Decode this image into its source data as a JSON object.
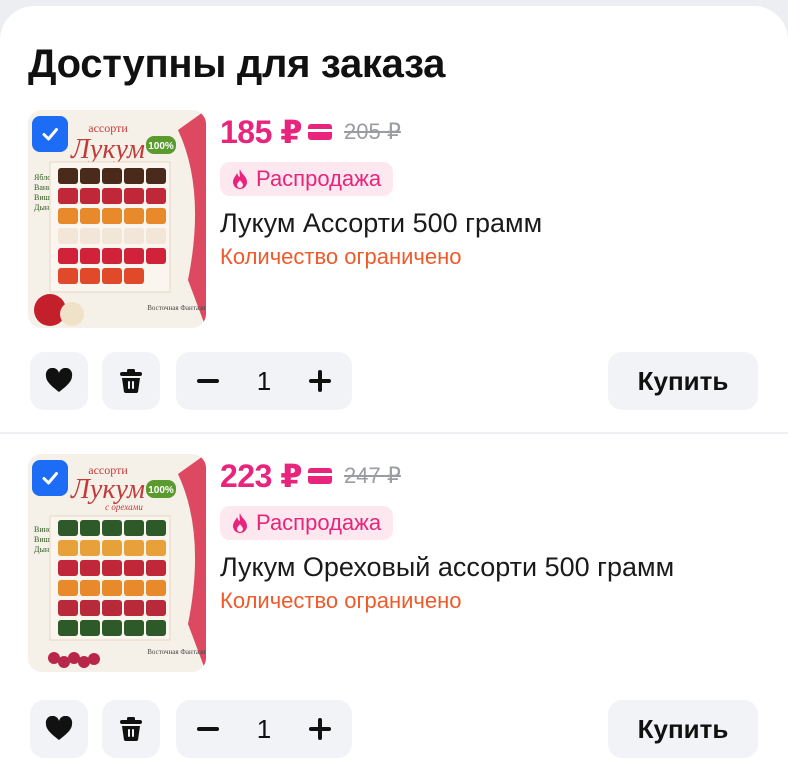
{
  "section": {
    "title": "Доступны для заказа"
  },
  "items": [
    {
      "price": "185 ₽",
      "old_price": "205 ₽",
      "badge": "Распродажа",
      "name": "Лукум Ассорти 500 грамм",
      "limited": "Количество ограничено",
      "quantity": "1",
      "buy_label": "Купить",
      "image": {
        "brand_top": "ассорти",
        "brand": "Лукум",
        "flavors": [
          "Яблоко",
          "Ваниль",
          "Вишня",
          "Дыня"
        ],
        "maker": "Восточная Фантазия",
        "natural": "100%"
      }
    },
    {
      "price": "223 ₽",
      "old_price": "247 ₽",
      "badge": "Распродажа",
      "name": "Лукум Ореховый ассорти 500 грамм",
      "limited": "Количество ограничено",
      "quantity": "1",
      "buy_label": "Купить",
      "image": {
        "brand_top": "ассорти",
        "brand": "Лукум",
        "subtitle": "с орехами",
        "flavors": [
          "Виноград",
          "Вишня",
          "Дыня"
        ],
        "maker": "Восточная Фантазия",
        "natural": "100%"
      }
    }
  ],
  "colors": {
    "accent_pink": "#e8247c",
    "warning_orange": "#ef5a2b",
    "checkbox_blue": "#1c6cf5",
    "button_bg": "#f2f3f6"
  },
  "icons": {
    "checkbox": "check-icon",
    "fav": "heart-icon",
    "delete": "trash-icon",
    "minus": "minus-icon",
    "plus": "plus-icon",
    "sale": "flame-icon",
    "payment": "card-icon"
  }
}
